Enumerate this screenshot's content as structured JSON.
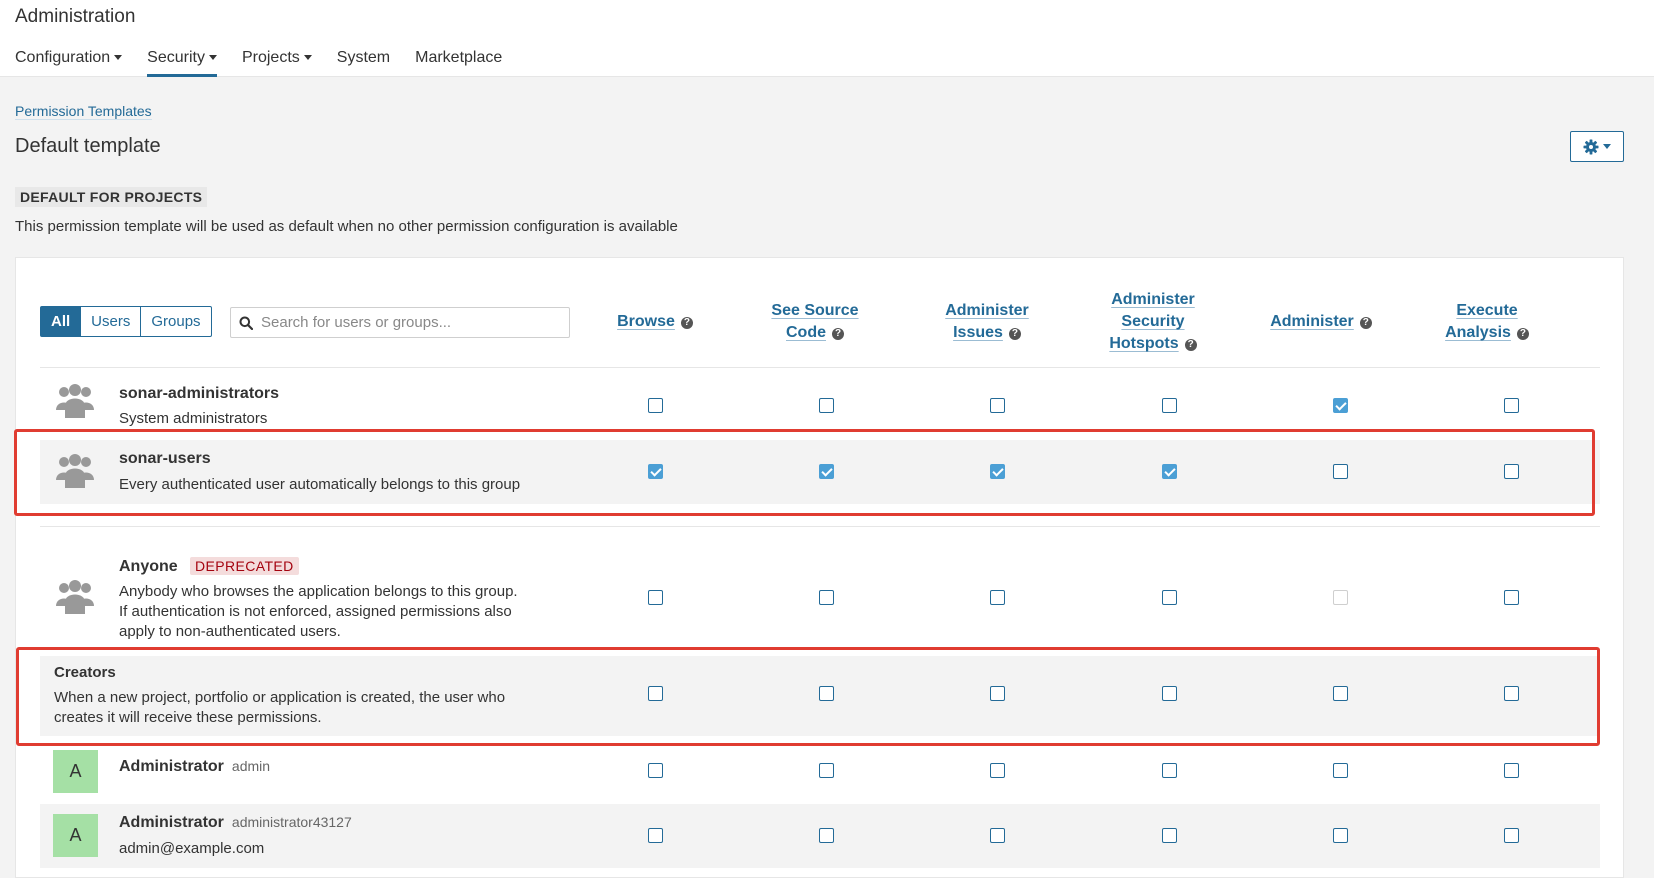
{
  "header": {
    "title": "Administration"
  },
  "nav": [
    {
      "label": "Configuration",
      "dropdown": true,
      "active": false
    },
    {
      "label": "Security",
      "dropdown": true,
      "active": true
    },
    {
      "label": "Projects",
      "dropdown": true,
      "active": false
    },
    {
      "label": "System",
      "dropdown": false,
      "active": false
    },
    {
      "label": "Marketplace",
      "dropdown": false,
      "active": false
    }
  ],
  "breadcrumb": "Permission Templates",
  "page_title": "Default template",
  "default_badge": "DEFAULT FOR PROJECTS",
  "description": "This permission template will be used as default when no other permission configuration is available",
  "filter": {
    "all": "All",
    "users": "Users",
    "groups": "Groups",
    "selected": "All",
    "search_placeholder": "Search for users or groups..."
  },
  "columns": [
    {
      "lines": [
        "Browse"
      ]
    },
    {
      "lines": [
        "See Source",
        "Code"
      ]
    },
    {
      "lines": [
        "Administer",
        "Issues"
      ]
    },
    {
      "lines": [
        "Administer",
        "Security",
        "Hotspots"
      ]
    },
    {
      "lines": [
        "Administer"
      ]
    },
    {
      "lines": [
        "Execute",
        "Analysis"
      ]
    }
  ],
  "rows": [
    {
      "kind": "group",
      "name": "sonar-administrators",
      "description": "System administrators",
      "perms": [
        false,
        false,
        false,
        false,
        true,
        false
      ]
    },
    {
      "kind": "group",
      "name": "sonar-users",
      "description": "Every authenticated user automatically belongs to this group",
      "perms": [
        true,
        true,
        true,
        true,
        false,
        false
      ]
    },
    {
      "kind": "group",
      "name": "Anyone",
      "badge": "DEPRECATED",
      "description_lines": [
        "Anybody who browses the application belongs to this group.",
        "If authentication is not enforced, assigned permissions also",
        "apply to non-authenticated users."
      ],
      "perms": [
        false,
        false,
        false,
        false,
        false,
        false
      ],
      "disabled": [
        false,
        false,
        false,
        false,
        true,
        false
      ]
    },
    {
      "kind": "creator",
      "name": "Creators",
      "description_lines": [
        "When a new project, portfolio or application is created, the user who",
        "creates it will receive these permissions."
      ],
      "perms": [
        false,
        false,
        false,
        false,
        false,
        false
      ]
    },
    {
      "kind": "user",
      "avatar": "A",
      "name": "Administrator",
      "login": "admin",
      "perms": [
        false,
        false,
        false,
        false,
        false,
        false
      ]
    },
    {
      "kind": "user",
      "avatar": "A",
      "name": "Administrator",
      "login": "administrator43127",
      "email": "admin@example.com",
      "perms": [
        false,
        false,
        false,
        false,
        false,
        false
      ]
    }
  ],
  "colors": {
    "accent": "#236a97",
    "checked": "#4b9fd5",
    "highlight": "#e03c31",
    "deprecated_bg": "#f4dcdc",
    "avatar_bg": "#a5e0a5"
  }
}
